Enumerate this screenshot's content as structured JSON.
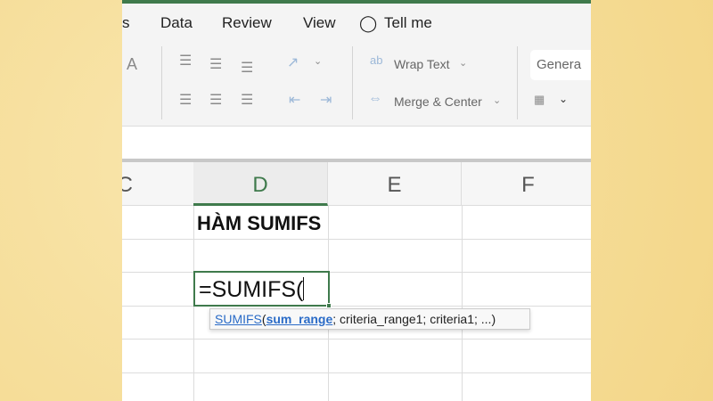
{
  "ribbon": {
    "tabs": [
      "s",
      "Data",
      "Review",
      "View",
      "Tell me"
    ],
    "wrap_text": "Wrap Text",
    "merge_center": "Merge & Center",
    "number_format": "Genera",
    "font_size_icon": "A"
  },
  "columns": [
    "C",
    "D",
    "E",
    "F"
  ],
  "cells": {
    "D1": "HÀM SUMIFS",
    "D3": "=SUMIFS("
  },
  "tooltip": {
    "func": "SUMIFS",
    "open": "(",
    "arg1": "sum_range",
    "rest": "; criteria_range1; criteria1; ...)"
  }
}
